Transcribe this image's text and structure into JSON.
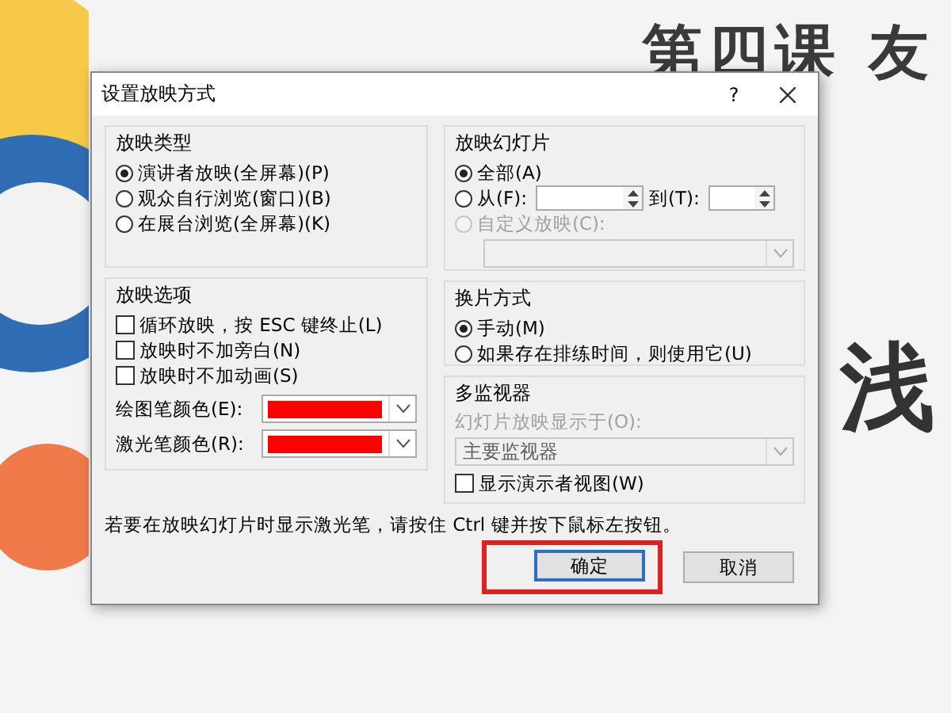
{
  "slide": {
    "title": "第四课 友",
    "word": "浅"
  },
  "dialog": {
    "title": "设置放映方式",
    "help": "?",
    "show_type": {
      "title": "放映类型",
      "options": [
        {
          "label": "演讲者放映(全屏幕)(P)",
          "selected": true
        },
        {
          "label": "观众自行浏览(窗口)(B)",
          "selected": false
        },
        {
          "label": "在展台浏览(全屏幕)(K)",
          "selected": false
        }
      ]
    },
    "show_options": {
      "title": "放映选项",
      "checkboxes": [
        {
          "label": "循环放映，按 ESC 键终止(L)",
          "checked": false
        },
        {
          "label": "放映时不加旁白(N)",
          "checked": false
        },
        {
          "label": "放映时不加动画(S)",
          "checked": false
        }
      ],
      "pens": [
        {
          "label": "绘图笔颜色(E):",
          "color": "#ff0000"
        },
        {
          "label": "激光笔颜色(R):",
          "color": "#ff0000"
        }
      ]
    },
    "show_slides": {
      "title": "放映幻灯片",
      "options": [
        {
          "kind": "plain",
          "label": "全部(A)",
          "selected": true,
          "disabled": false
        },
        {
          "kind": "range",
          "label": "从(F):",
          "to_label": "到(T):",
          "selected": false,
          "disabled": false
        },
        {
          "kind": "custom",
          "label": "自定义放映(C):",
          "selected": false,
          "disabled": true
        }
      ]
    },
    "advance": {
      "title": "换片方式",
      "options": [
        {
          "label": "手动(M)",
          "selected": true
        },
        {
          "label": "如果存在排练时间，则使用它(U)",
          "selected": false
        }
      ]
    },
    "monitors": {
      "title": "多监视器",
      "label": "幻灯片放映显示于(O):",
      "value": "主要监视器",
      "disabled": true,
      "checkbox": {
        "label": "显示演示者视图(W)",
        "checked": false
      }
    },
    "hint": "若要在放映幻灯片时显示激光笔，请按住 Ctrl 键并按下鼠标左按钮。",
    "buttons": [
      {
        "label": "确定",
        "default": true,
        "highlighted": true
      },
      {
        "label": "取消",
        "default": false,
        "highlighted": false
      }
    ]
  }
}
